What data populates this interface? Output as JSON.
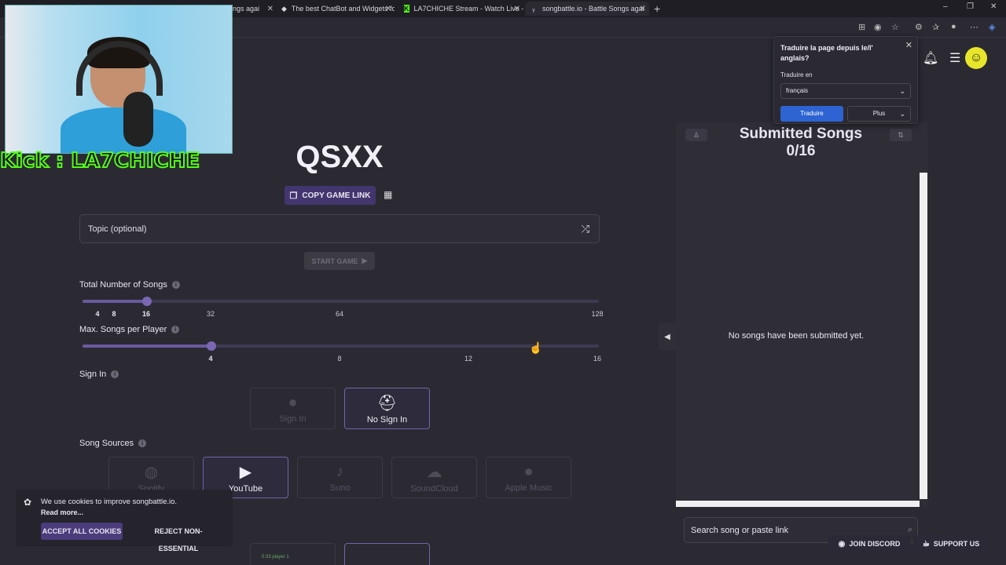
{
  "browser": {
    "tabs": [
      {
        "label": "ngs agai",
        "favicon": "page-icon"
      },
      {
        "label": "The best ChatBot and Widgets fo",
        "favicon": "diamond-icon"
      },
      {
        "label": "LA7CHICHE Stream - Watch Live -",
        "favicon": "kick-icon"
      },
      {
        "label": "songbattle.io - Battle Songs agai",
        "favicon": "songbattle-icon"
      }
    ],
    "new_tab": "+",
    "controls": [
      "–",
      "❐",
      "✕"
    ]
  },
  "webcam": {
    "overlay_text": "Kick : LA7CHICHE"
  },
  "game": {
    "code": "QSXX",
    "copy_label": "COPY GAME LINK",
    "topic_placeholder": "Topic (optional)",
    "start_label": "START GAME"
  },
  "total_songs": {
    "label": "Total Number of Songs",
    "ticks": [
      "4",
      "8",
      "16",
      "32",
      "64",
      "128"
    ],
    "value": "16"
  },
  "max_songs": {
    "label": "Max. Songs per Player",
    "ticks": [
      "4",
      "8",
      "12",
      "16"
    ],
    "value": "4"
  },
  "sign_in": {
    "label": "Sign In",
    "options": [
      {
        "label": "Sign In",
        "icon": "user-icon",
        "selected": false
      },
      {
        "label": "No Sign In",
        "icon": "incognito-icon",
        "selected": true
      }
    ]
  },
  "song_sources": {
    "label": "Song Sources",
    "options": [
      {
        "label": "Spotify",
        "icon": "spotify-icon",
        "selected": false
      },
      {
        "label": "YouTube",
        "icon": "youtube-icon",
        "selected": true
      },
      {
        "label": "Suno",
        "icon": "suno-icon",
        "selected": false
      },
      {
        "label": "SoundCloud",
        "icon": "soundcloud-icon",
        "selected": false
      },
      {
        "label": "Apple Music",
        "icon": "apple-icon",
        "selected": false
      }
    ]
  },
  "submitted": {
    "title": "Submitted Songs",
    "count": "0/16",
    "empty": "No songs have been submitted yet.",
    "search_placeholder": "Search song or paste link"
  },
  "translate": {
    "title": "Traduire la page depuis le/l' anglais?",
    "to_label": "Traduire en",
    "language": "français",
    "translate_btn": "Traduire",
    "more_btn": "Plus"
  },
  "cookie": {
    "text": "We use cookies to improve songbattle.io.",
    "read_more": "Read more...",
    "accept": "ACCEPT ALL COOKIES",
    "reject": "REJECT NON-ESSENTIAL"
  },
  "bottom": {
    "preview_text": "0:33  player 1"
  },
  "footer": {
    "discord": "JOIN DISCORD",
    "support": "SUPPORT US"
  },
  "colors": {
    "background": "#2b2a33",
    "accent": "#43356e",
    "slider_fill": "#6a5a9e",
    "translate_blue": "#2d63d2",
    "avatar": "#e8e62a"
  }
}
